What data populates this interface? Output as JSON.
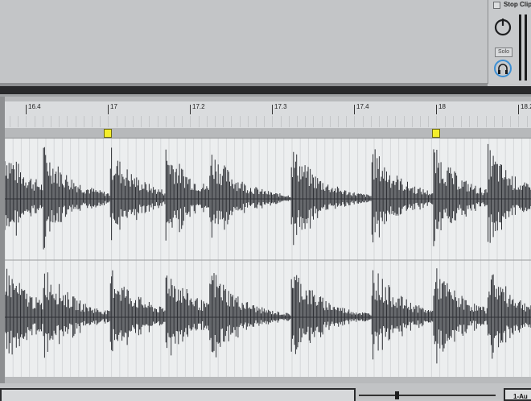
{
  "mixer": {
    "stop_clip_label": "Stop Clip",
    "solo_label": "Solo"
  },
  "ruler": {
    "labels": [
      "16.4",
      "17",
      "17.2",
      "17.3",
      "17.4",
      "18",
      "18.2"
    ]
  },
  "bottom": {
    "output_label": "1-Au"
  },
  "icons": {
    "knob": "pan-knob-icon",
    "phones": "headphones-cue-icon"
  },
  "colors": {
    "warp_marker": "#f4ee2a",
    "waveform": "#2f3136",
    "background": "#eceeef"
  }
}
